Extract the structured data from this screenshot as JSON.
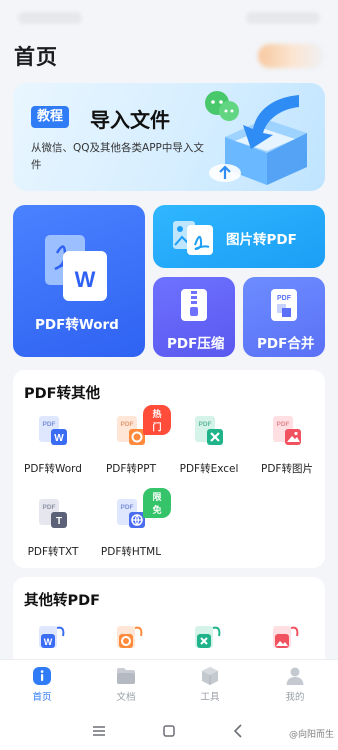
{
  "header": {
    "title": "首页"
  },
  "banner": {
    "tag": "教程",
    "title": "导入文件",
    "subtitle": "从微信、QQ及其他各类APP中导入文件"
  },
  "quick_cards": {
    "pdf_to_word": "PDF转Word",
    "image_to_pdf": "图片转PDF",
    "pdf_compress": "PDF压缩",
    "pdf_merge": "PDF合并"
  },
  "section_pdf_to_other": {
    "title": "PDF转其他",
    "items": [
      {
        "label": "PDF转Word",
        "icon": "pdf-to-word-icon",
        "badge": ""
      },
      {
        "label": "PDF转PPT",
        "icon": "pdf-to-ppt-icon",
        "badge": "热门"
      },
      {
        "label": "PDF转Excel",
        "icon": "pdf-to-excel-icon",
        "badge": ""
      },
      {
        "label": "PDF转图片",
        "icon": "pdf-to-image-icon",
        "badge": ""
      },
      {
        "label": "PDF转TXT",
        "icon": "pdf-to-txt-icon",
        "badge": ""
      },
      {
        "label": "PDF转HTML",
        "icon": "pdf-to-html-icon",
        "badge": "限免"
      }
    ]
  },
  "section_other_to_pdf": {
    "title": "其他转PDF"
  },
  "bottom_nav": [
    {
      "label": "首页",
      "icon": "home-icon",
      "active": true
    },
    {
      "label": "文档",
      "icon": "folder-icon",
      "active": false
    },
    {
      "label": "工具",
      "icon": "toolbox-icon",
      "active": false
    },
    {
      "label": "我的",
      "icon": "user-icon",
      "active": false
    }
  ],
  "watermark": "@向阳而生",
  "colors": {
    "accent": "#2f7cf6",
    "word_blue": "#3a6cf4",
    "ppt_orange": "#ff8a3c",
    "excel_teal": "#1fb38a",
    "image_red": "#f0525f",
    "hot_badge": "#ff4d3a",
    "free_badge": "#35c46a"
  }
}
